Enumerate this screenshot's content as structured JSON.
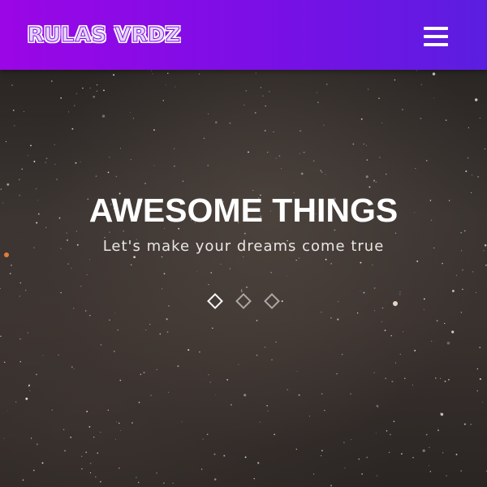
{
  "navbar": {
    "logo_text": "RULAS VRDZ",
    "menu_icon": "hamburger-menu-icon",
    "gradient": [
      "#9b06e6",
      "#5b1ee0"
    ]
  },
  "hero": {
    "title": "AWESOME THINGS",
    "subtitle": "Let's make your dreams come true",
    "background": "starry-night-sky",
    "slides": [
      {
        "label": "slide-1",
        "active": true
      },
      {
        "label": "slide-2",
        "active": false
      },
      {
        "label": "slide-3",
        "active": false
      }
    ]
  }
}
